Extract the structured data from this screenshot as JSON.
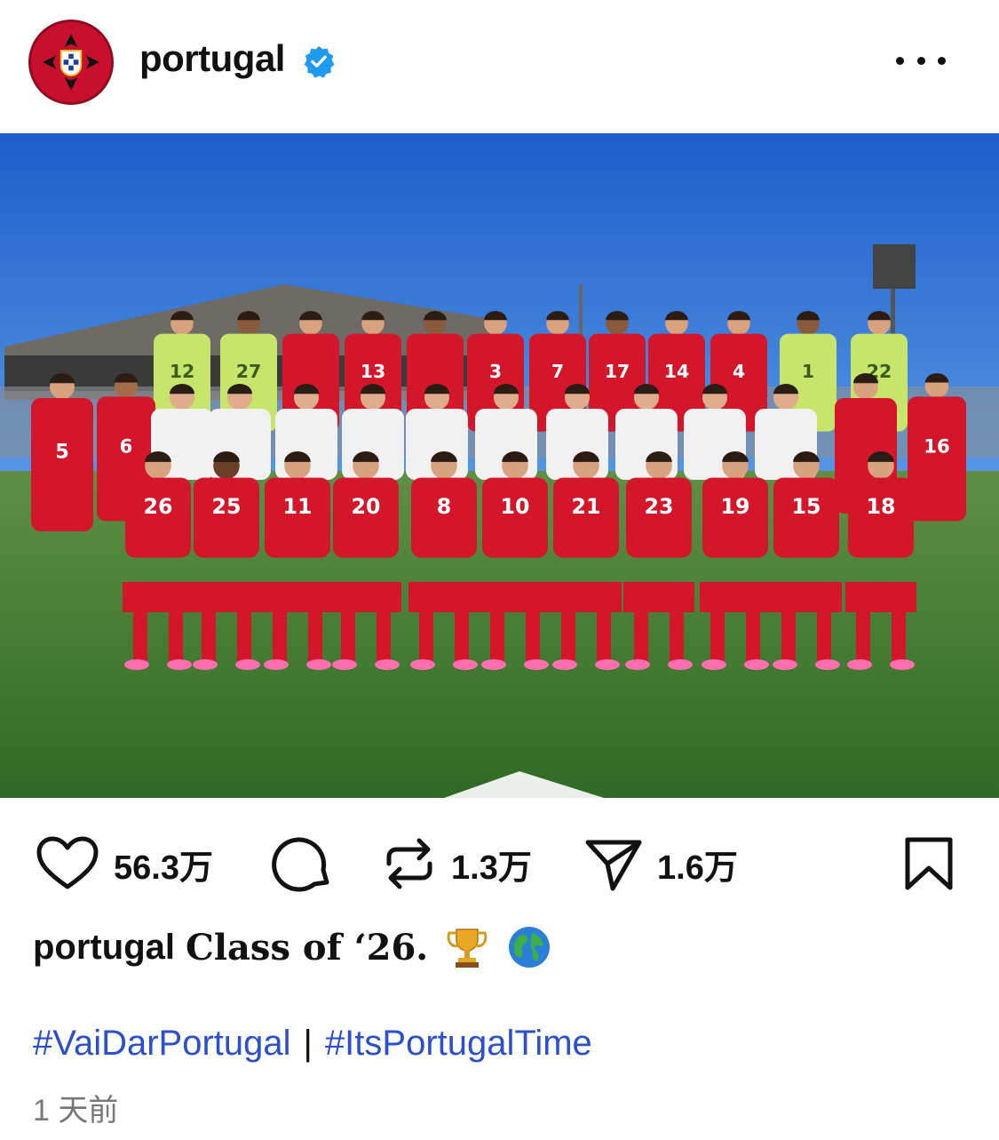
{
  "account": {
    "username": "portugal",
    "verified": true,
    "avatar_icon": "portugal-federation-crest-icon"
  },
  "photo": {
    "alt_icon": "team-photo",
    "jersey_numbers_back": [
      "12",
      "27",
      "13",
      "3",
      "7",
      "17",
      "14",
      "4",
      "1",
      "22"
    ],
    "jersey_numbers_middle": [
      "5",
      "6",
      "16"
    ],
    "jersey_numbers_front": [
      "26",
      "25",
      "11",
      "20",
      "8",
      "10",
      "21",
      "23",
      "19",
      "15",
      "18"
    ]
  },
  "actions": {
    "like_count": "56.3万",
    "repost_count": "1.3万",
    "share_count": "1.6万"
  },
  "caption": {
    "username": "portugal",
    "text": "Class of ‘26.",
    "emojis": [
      "trophy-icon",
      "globe-icon"
    ]
  },
  "hashtags": {
    "first": "#VaiDarPortugal",
    "separator": "|",
    "second": "#ItsPortugalTime"
  },
  "timestamp": "1 天前",
  "colors": {
    "text": "#111111",
    "hashtag": "#2b4fcf",
    "verified": "#1d9bf0",
    "muted": "#777777",
    "jersey_red": "#d4162b"
  }
}
